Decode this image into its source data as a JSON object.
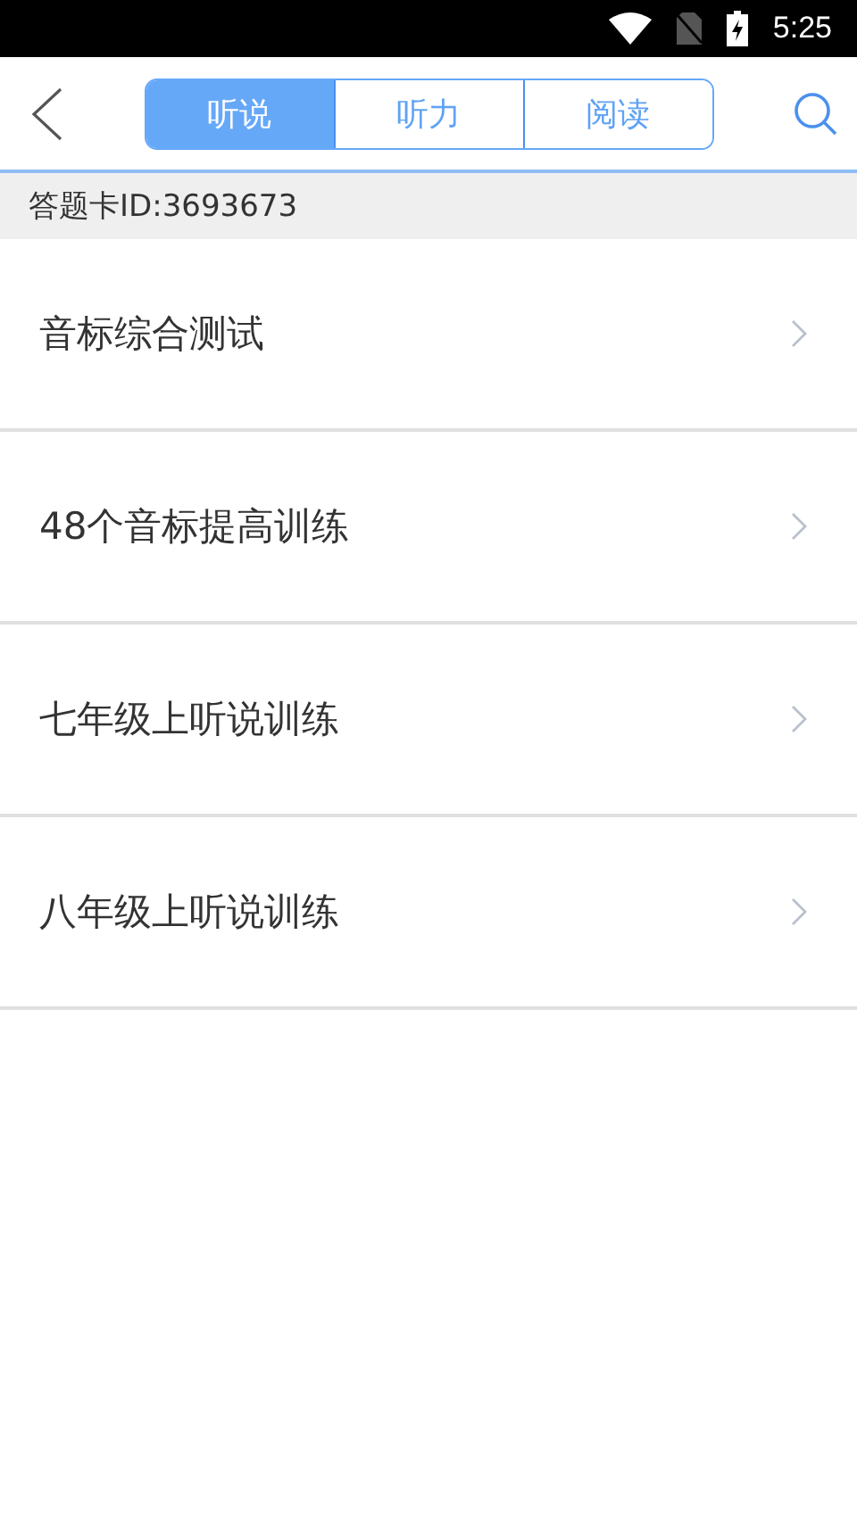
{
  "status_bar": {
    "time": "5:25"
  },
  "tabs": [
    {
      "label": "听说",
      "selected": true
    },
    {
      "label": "听力",
      "selected": false
    },
    {
      "label": "阅读",
      "selected": false
    }
  ],
  "card_id": "答题卡ID:3693673",
  "items": [
    {
      "title": "音标综合测试"
    },
    {
      "title": "48个音标提高训练"
    },
    {
      "title": "七年级上听说训练"
    },
    {
      "title": "八年级上听说训练"
    }
  ]
}
